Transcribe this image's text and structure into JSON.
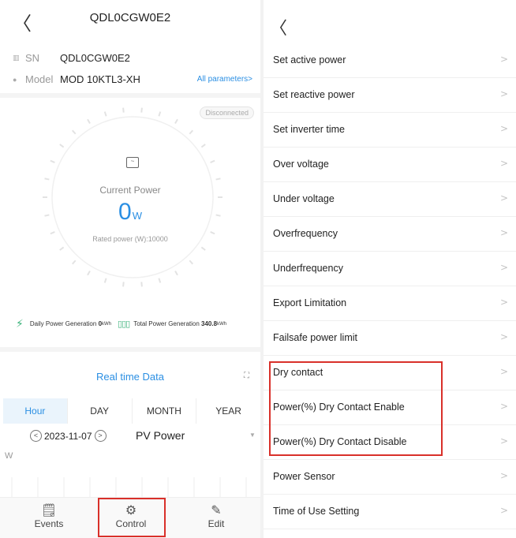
{
  "left": {
    "header": {
      "back_glyph": "〈",
      "title": "QDL0CGW0E2"
    },
    "info": {
      "sn_label": "SN",
      "sn_value": "QDL0CGW0E2",
      "model_label": "Model",
      "model_value": "MOD 10KTL3-XH",
      "all_params": "All parameters>"
    },
    "status_badge": "Disconnected",
    "gauge": {
      "label": "Current Power",
      "value": "0",
      "unit": "W",
      "rated": "Rated power (W):10000",
      "fill_fraction": 0
    },
    "generation": {
      "daily_label": "Daily Power Generation",
      "daily_value": "0",
      "daily_unit": "kWh",
      "total_label": "Total Power Generation",
      "total_value": "340.8",
      "total_unit": "kWh"
    },
    "realtime_title": "Real time Data",
    "tabs": [
      "Hour",
      "DAY",
      "MONTH",
      "YEAR"
    ],
    "active_tab": "Hour",
    "date_nav": {
      "prev": "<",
      "date": "2023-11-07",
      "next": ">"
    },
    "metric_select": "PV Power",
    "chart_unit": "W",
    "bottom_nav": [
      {
        "label": "Events",
        "icon": "events-icon"
      },
      {
        "label": "Control",
        "icon": "gear-icon"
      },
      {
        "label": "Edit",
        "icon": "edit-icon"
      }
    ]
  },
  "right": {
    "back_glyph": "〈",
    "items": [
      "Set active power",
      "Set reactive power",
      "Set inverter time",
      "Over voltage",
      "Under voltage",
      "Overfrequency",
      "Underfrequency",
      "Export Limitation",
      "Failsafe power limit",
      "Dry contact",
      "Power(%) Dry Contact Enable",
      "Power(%) Dry Contact Disable",
      "Power Sensor",
      "Time of Use Setting"
    ],
    "chevron": ">"
  },
  "colors": {
    "accent": "#2b8fe3",
    "highlight": "#d9302a",
    "green": "#3bb27a"
  }
}
